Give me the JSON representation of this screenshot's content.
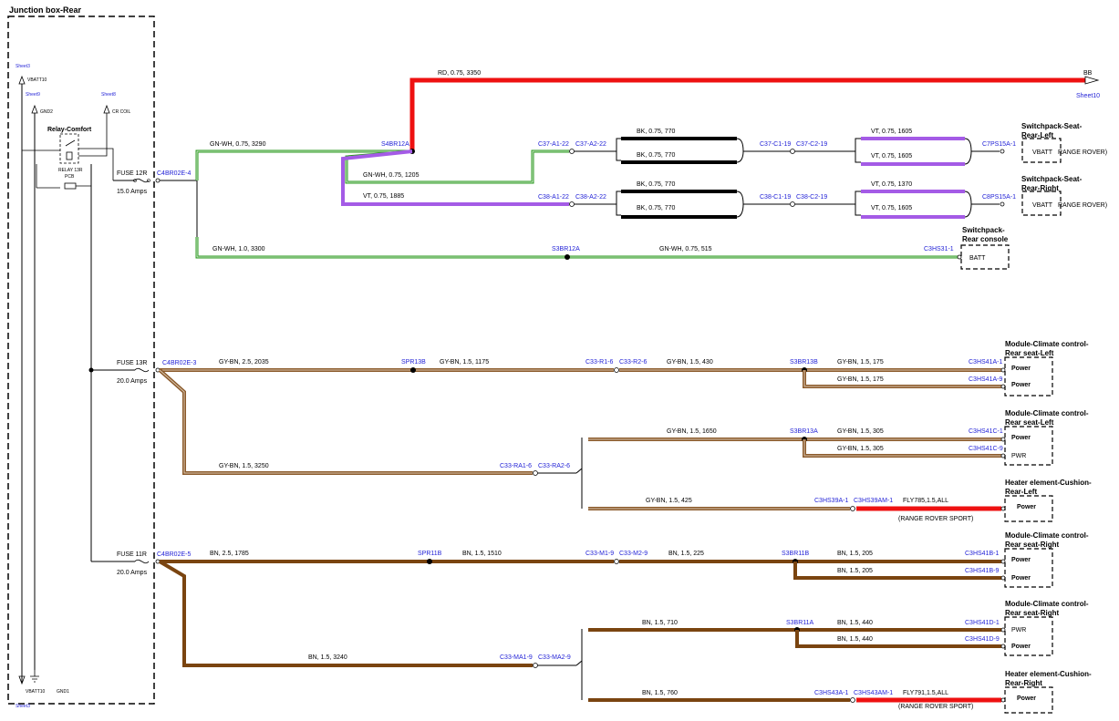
{
  "junction_box": {
    "title": "Junction box-Rear",
    "sheet_top": "Sheet3",
    "vbatt10_top": "VBATT10",
    "sheet_gnd": "Sheet9",
    "gnd2": "GND2",
    "sheet_cr": "Sheet8",
    "cr_coil": "CR COIL",
    "relay_title": "Relay-Comfort",
    "relay_label": "RELAY 13R",
    "pcb": "PCB",
    "vbatt10_bottom": "VBATT10",
    "gnd1": "GND1",
    "sheet_bottom": "Sheet3"
  },
  "fuses": [
    {
      "name": "FUSE 12R",
      "rating": "15.0 Amps",
      "connector": "C4BR02E-4"
    },
    {
      "name": "FUSE 13R",
      "rating": "20.0 Amps",
      "connector": "C4BR02E-3"
    },
    {
      "name": "FUSE 11R",
      "rating": "20.0 Amps",
      "connector": "C4BR02E-5"
    }
  ],
  "wires": {
    "rd_top": "RD, 0.75, 3350",
    "bb": "BB",
    "sheet10": "Sheet10",
    "gnwh_3290": "GN-WH, 0.75, 3290",
    "s4br12a": "S4BR12A",
    "gnwh_1205": "GN-WH, 0.75, 1205",
    "vt_1885": "VT, 0.75, 1885",
    "c37a1": "C37-A1-22",
    "c37a2": "C37-A2-22",
    "c38a1": "C38-A1-22",
    "c38a2": "C38-A2-22",
    "bk_770": "BK, 0.75, 770",
    "c37c1": "C37-C1-19",
    "c37c2": "C37-C2-19",
    "c38c1": "C38-C1-19",
    "c38c2": "C38-C2-19",
    "vt_1605": "VT, 0.75, 1605",
    "vt_1370": "VT, 0.75, 1370",
    "c7ps15a": "C7PS15A-1",
    "c8ps15a": "C8PS15A-1",
    "gnwh_3300": "GN-WH, 1.0, 3300",
    "s3br12a": "S3BR12A",
    "gnwh_515": "GN-WH, 0.75, 515",
    "c3hs31": "C3HS31-1",
    "gybn_2035": "GY-BN, 2.5, 2035",
    "spr13b": "SPR13B",
    "gybn_1175": "GY-BN, 1.5, 1175",
    "c33r1": "C33-R1-6",
    "c33r2": "C33-R2-6",
    "gybn_430": "GY-BN, 1.5, 430",
    "s3br13b": "S3BR13B",
    "gybn_175": "GY-BN, 1.5, 175",
    "c3hs41a1": "C3HS41A-1",
    "c3hs41a9": "C3HS41A-9",
    "gybn_1650": "GY-BN, 1.5, 1650",
    "s3br13a": "S3BR13A",
    "gybn_305": "GY-BN, 1.5, 305",
    "c3hs41c1": "C3HS41C-1",
    "c3hs41c9": "C3HS41C-9",
    "gybn_3250": "GY-BN, 1.5, 3250",
    "c33ra1": "C33-RA1-6",
    "c33ra2": "C33-RA2-6",
    "gybn_425": "GY-BN, 1.5, 425",
    "c3hs39a": "C3HS39A-1",
    "c3hs39am": "C3HS39AM-1",
    "fly785": "FLY785,1.5,ALL",
    "rrsport1": "(RANGE ROVER SPORT)",
    "bn_1785": "BN, 2.5, 1785",
    "spr11b": "SPR11B",
    "bn_1510": "BN, 1.5, 1510",
    "c33m1": "C33-M1-9",
    "c33m2": "C33-M2-9",
    "bn_225": "BN, 1.5, 225",
    "s3br11b": "S3BR11B",
    "bn_205": "BN, 1.5, 205",
    "c3hs41b1": "C3HS41B-1",
    "c3hs41b9": "C3HS41B-9",
    "bn_710": "BN, 1.5, 710",
    "s3br11a": "S3BR11A",
    "bn_440": "BN, 1.5, 440",
    "c3hs41d1": "C3HS41D-1",
    "c3hs41d9": "C3HS41D-9",
    "bn_3240": "BN, 1.5, 3240",
    "c33ma1": "C33-MA1-9",
    "c33ma2": "C33-MA2-9",
    "bn_760": "BN, 1.5, 760",
    "c3hs43a": "C3HS43A-1",
    "c3hs43am": "C3HS43AM-1",
    "fly791": "FLY791,1.5,ALL",
    "rrsport2": "(RANGE ROVER SPORT)"
  },
  "components": {
    "seat_left": "Switchpack-Seat-Rear-Left",
    "seat_right": "Switchpack-Seat-Rear-Right",
    "vbatt": "VBATT",
    "range_rover": "RANGE ROVER)",
    "console": "Switchpack-Rear console",
    "batt": "BATT",
    "climate_left": "Module-Climate control-Rear seat-Left",
    "climate_right": "Module-Climate control-Rear seat-Right",
    "power": "Power",
    "pwr": "PWR",
    "heater_left": "Heater element-Cushion-Rear-Left",
    "heater_right": "Heater element-Cushion-Rear-Right"
  },
  "colors": {
    "red": "#ee1111",
    "green": "#2a9a1e",
    "violet": "#a45be6",
    "black": "#000000",
    "grey_brown": "#8b5a2b",
    "brown": "#7a4410",
    "ref_blue": "#1f1fd6"
  }
}
